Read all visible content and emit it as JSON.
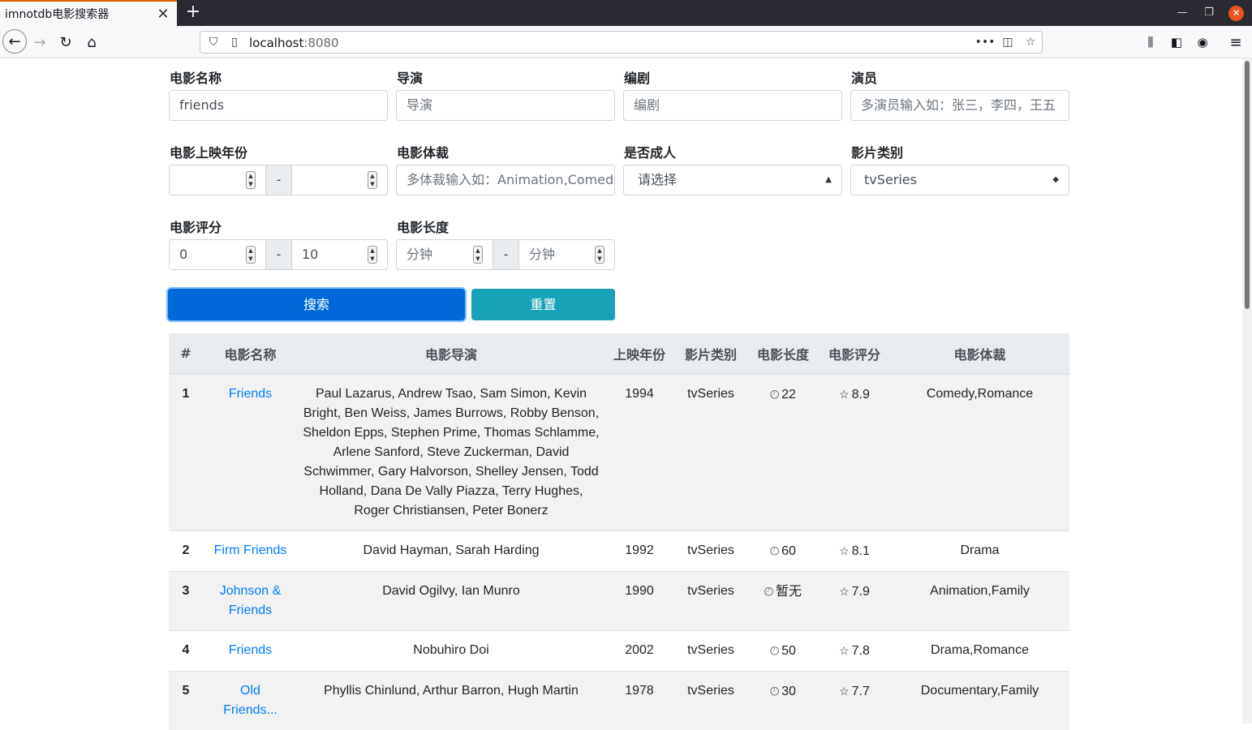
{
  "browser": {
    "tab_title": "imnotdb电影搜索器",
    "url_host": "localhost",
    "url_port": ":8080"
  },
  "form": {
    "name_label": "电影名称",
    "name_value": "friends",
    "director_label": "导演",
    "director_placeholder": "导演",
    "writer_label": "编剧",
    "writer_placeholder": "编剧",
    "actor_label": "演员",
    "actor_placeholder": "多演员输入如：张三，李四，王五",
    "year_label": "电影上映年份",
    "genre_label": "电影体裁",
    "genre_placeholder": "多体裁输入如：Animation,Comedy",
    "adult_label": "是否成人",
    "adult_value": "请选择",
    "type_label": "影片类别",
    "type_value": "tvSeries",
    "rating_label": "电影评分",
    "rating_min": "0",
    "rating_max": "10",
    "length_label": "电影长度",
    "length_min_placeholder": "分钟",
    "length_max_placeholder": "分钟",
    "dash": "-",
    "search_button": "搜索",
    "reset_button": "重置"
  },
  "table": {
    "headers": [
      "#",
      "电影名称",
      "电影导演",
      "上映年份",
      "影片类别",
      "电影长度",
      "电影评分",
      "电影体裁"
    ],
    "rows": [
      {
        "idx": "1",
        "title": "Friends",
        "directors": "Paul Lazarus, Andrew Tsao, Sam Simon, Kevin Bright, Ben Weiss, James Burrows, Robby Benson, Sheldon Epps, Stephen Prime, Thomas Schlamme, Arlene Sanford, Steve Zuckerman, David Schwimmer, Gary Halvorson, Shelley Jensen, Todd Holland, Dana De Vally Piazza, Terry Hughes, Roger Christiansen, Peter Bonerz",
        "year": "1994",
        "type": "tvSeries",
        "length": "22",
        "rating": "8.9",
        "genres": "Comedy,Romance"
      },
      {
        "idx": "2",
        "title": "Firm Friends",
        "directors": "David Hayman, Sarah Harding",
        "year": "1992",
        "type": "tvSeries",
        "length": "60",
        "rating": "8.1",
        "genres": "Drama"
      },
      {
        "idx": "3",
        "title": "Johnson & Friends",
        "directors": "David Ogilvy, Ian Munro",
        "year": "1990",
        "type": "tvSeries",
        "length": "暂无",
        "rating": "7.9",
        "genres": "Animation,Family"
      },
      {
        "idx": "4",
        "title": "Friends",
        "directors": "Nobuhiro Doi",
        "year": "2002",
        "type": "tvSeries",
        "length": "50",
        "rating": "7.8",
        "genres": "Drama,Romance"
      },
      {
        "idx": "5",
        "title": "Old Friends...",
        "directors": "Phyllis Chinlund, Arthur Barron, Hugh Martin",
        "year": "1978",
        "type": "tvSeries",
        "length": "30",
        "rating": "7.7",
        "genres": "Documentary,Family"
      }
    ]
  },
  "icons": {
    "clock": "clock-icon",
    "star": "star-icon"
  }
}
